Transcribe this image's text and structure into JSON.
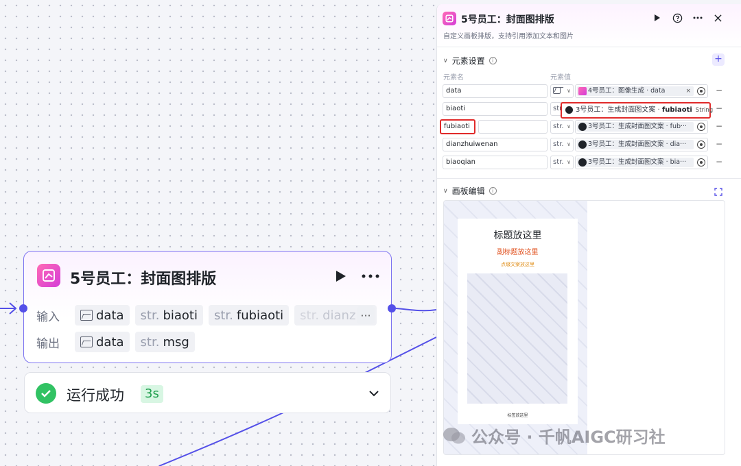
{
  "node": {
    "title": "5号员工：封面图排版",
    "input_label": "输入",
    "output_label": "输出",
    "inputs": [
      {
        "type": "image",
        "name": "data"
      },
      {
        "type": "str.",
        "name": "biaoti"
      },
      {
        "type": "str.",
        "name": "fubiaoti"
      },
      {
        "type": "str.",
        "name": "dianzhu"
      }
    ],
    "outputs": [
      {
        "type": "image",
        "name": "data"
      },
      {
        "type": "str.",
        "name": "msg"
      }
    ],
    "more": "···"
  },
  "status": {
    "text": "运行成功",
    "time": "3s"
  },
  "panel": {
    "title": "5号员工：封面图排版",
    "description": "自定义画板排版，支持引用添加文本和图片",
    "section_elements": "元素设置",
    "col_name": "元素名",
    "col_value": "元素值",
    "add": "+",
    "rows": [
      {
        "name": "data",
        "type": "",
        "value": "4号员工：图像生成 · data",
        "icon": "pink"
      },
      {
        "name": "biaoti",
        "type": "str.",
        "value": "",
        "icon": ""
      },
      {
        "name": "fubiaoti",
        "type": "str.",
        "value": "3号员工：生成封面图文案 · fub···",
        "icon": "dark"
      },
      {
        "name": "dianzhuiwenan",
        "type": "str.",
        "value": "3号员工：生成封面图文案 · dia···",
        "icon": "dark"
      },
      {
        "name": "biaoqian",
        "type": "str.",
        "value": "3号员工：生成封面图文案 · bia···",
        "icon": "dark"
      }
    ],
    "tooltip": {
      "prefix": "3号员工：生成封面图文案 · ",
      "name": "fubiaoti",
      "type": "String"
    },
    "section_board": "画板编辑",
    "artboard": {
      "title": "标题放这里",
      "subtitle": "副标题放这里",
      "text": "点缀文案放这里",
      "tag": "标签放这里"
    }
  },
  "watermark": "公众号 · 千帆AIGC研习社",
  "colors": {
    "accent": "#5450e8",
    "success": "#31c263",
    "highlight": "#e02a2a",
    "brand": "#d43dd8"
  }
}
